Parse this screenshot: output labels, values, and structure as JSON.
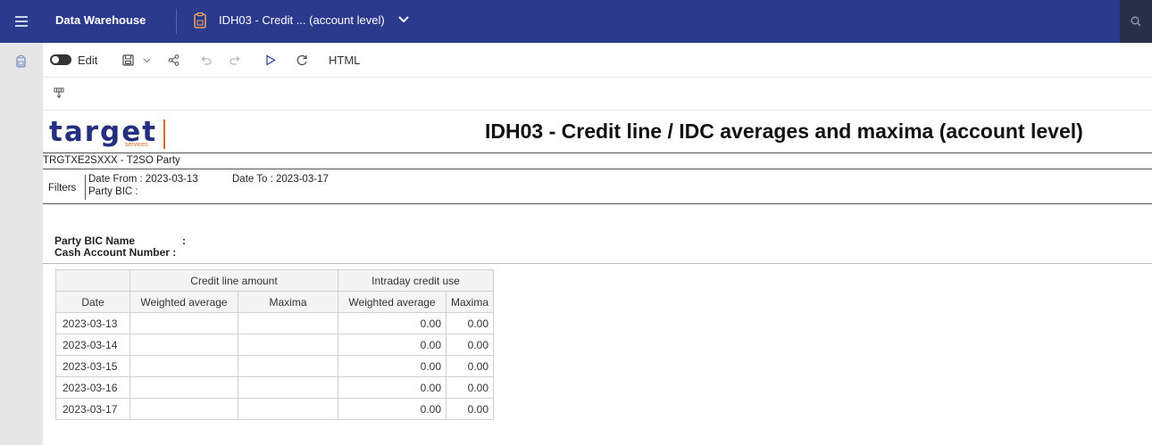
{
  "topbar": {
    "app_title": "Data Warehouse",
    "doc_title": "IDH03 - Credit ... (account level)"
  },
  "toolbar": {
    "edit_label": "Edit",
    "html_label": "HTML"
  },
  "report": {
    "logo_text": "target",
    "logo_sub": "services",
    "title": "IDH03 - Credit line / IDC averages and maxima (account level)",
    "party": "TRGTXE2SXXX - T2SO Party",
    "filters_label": "Filters",
    "date_from": "Date From : 2023-03-13",
    "date_to": "Date To : 2023-03-17",
    "party_bic": "Party BIC  :",
    "party_bic_name_label": "Party BIC Name",
    "cash_account_label": "Cash Account Number :",
    "colon": ":"
  },
  "table": {
    "group_headers": [
      "Credit line amount",
      "Intraday credit use"
    ],
    "headers": [
      "Date",
      "Weighted average",
      "Maxima",
      "Weighted average",
      "Maxima"
    ],
    "rows": [
      {
        "date": "2023-03-13",
        "wa": "",
        "max": "",
        "icu_wa": "0.00",
        "icu_max": "0.00"
      },
      {
        "date": "2023-03-14",
        "wa": "",
        "max": "",
        "icu_wa": "0.00",
        "icu_max": "0.00"
      },
      {
        "date": "2023-03-15",
        "wa": "",
        "max": "",
        "icu_wa": "0.00",
        "icu_max": "0.00"
      },
      {
        "date": "2023-03-16",
        "wa": "",
        "max": "",
        "icu_wa": "0.00",
        "icu_max": "0.00"
      },
      {
        "date": "2023-03-17",
        "wa": "",
        "max": "",
        "icu_wa": "0.00",
        "icu_max": "0.00"
      }
    ]
  },
  "colors": {
    "topbar": "#2b3a8d",
    "logo_blue": "#24307f",
    "logo_orange": "#e0672a"
  }
}
